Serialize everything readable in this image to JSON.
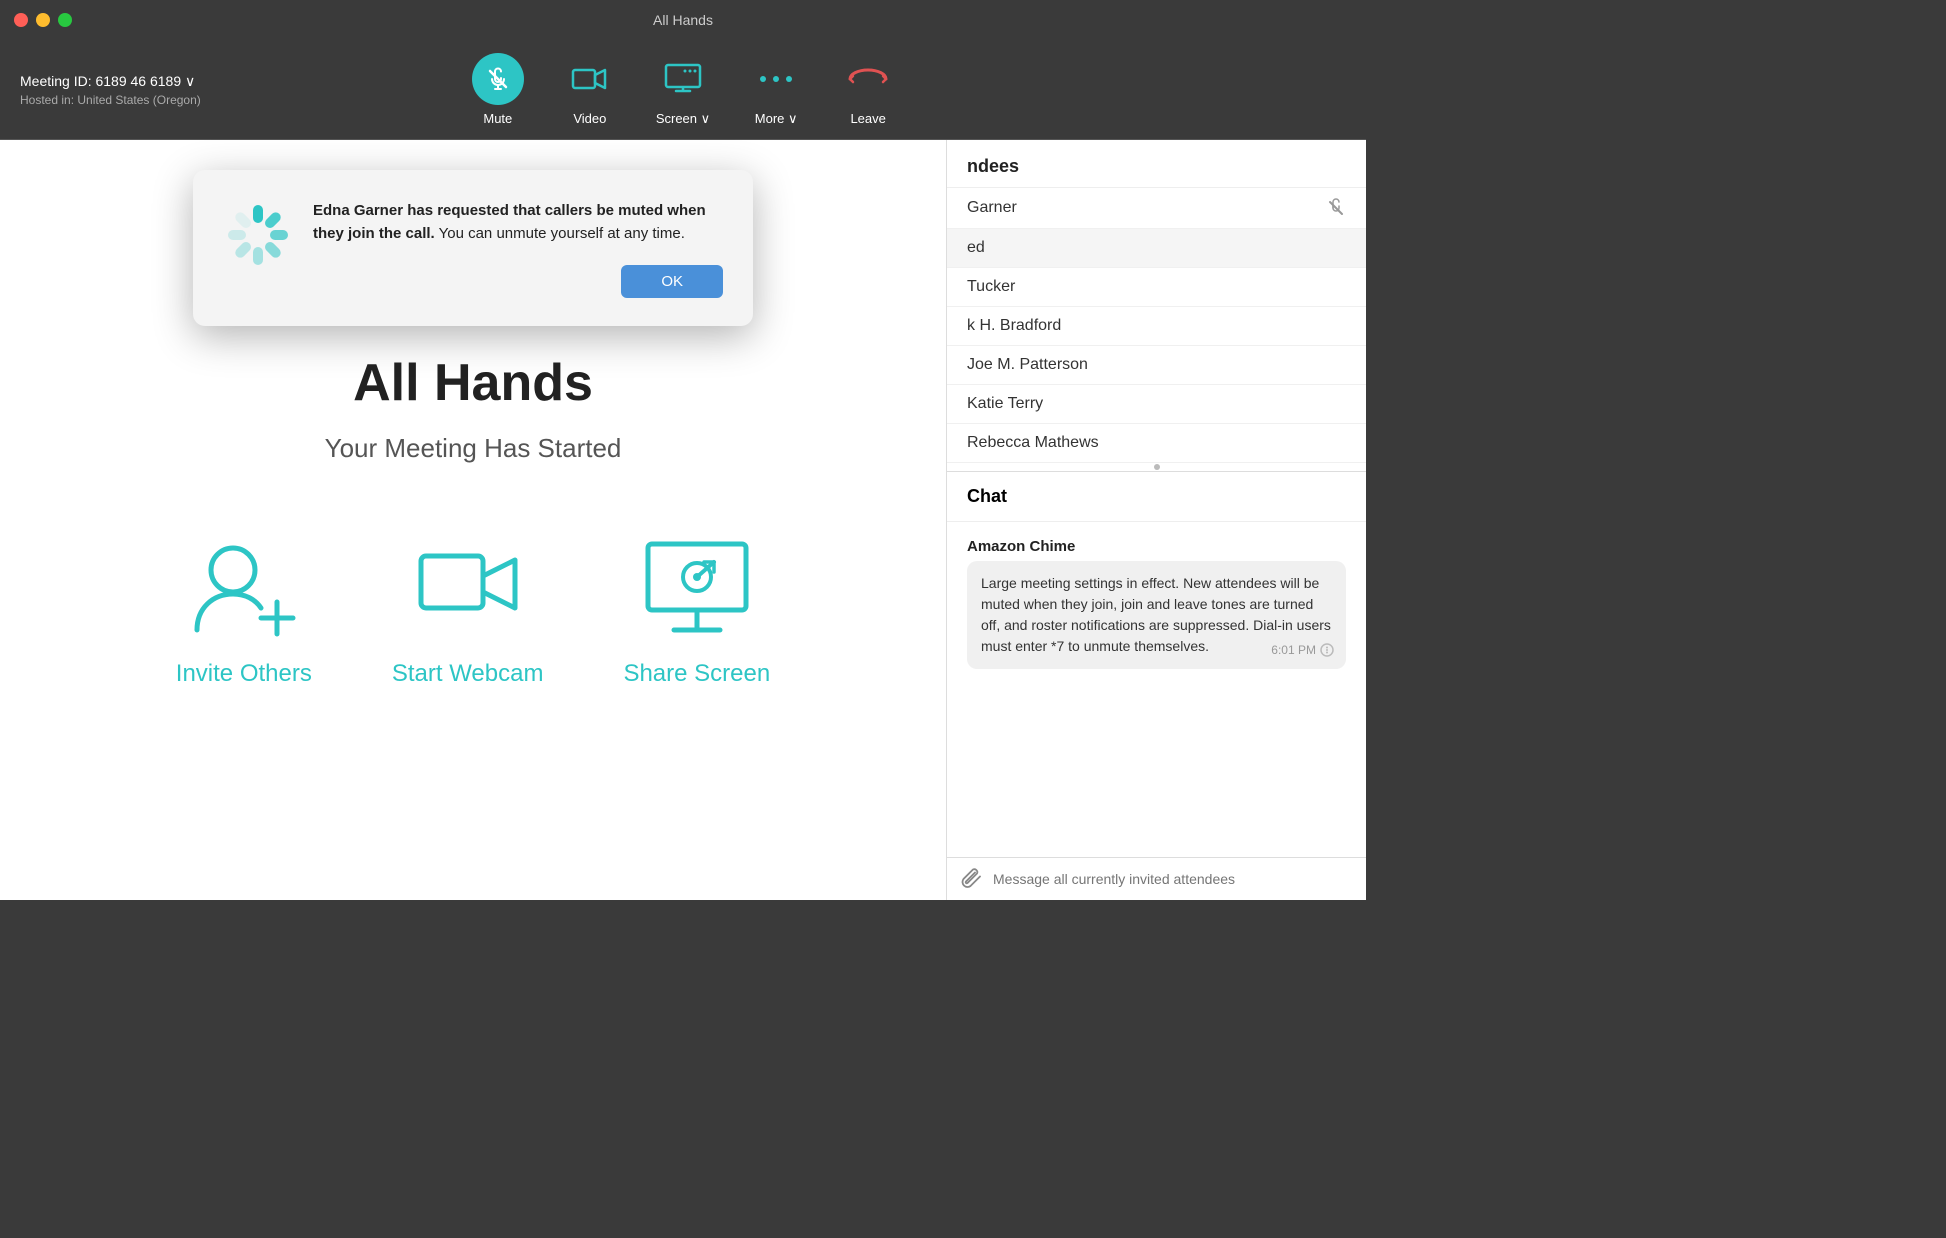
{
  "window": {
    "title": "All Hands"
  },
  "toolbar": {
    "mute_label": "Mute",
    "video_label": "Video",
    "screen_label": "Screen ∨",
    "more_label": "More ∨",
    "leave_label": "Leave"
  },
  "meeting": {
    "id_label": "Meeting ID: 6189 46 6189 ∨",
    "hosted_label": "Hosted in: United States (Oregon)",
    "title": "All Hands",
    "subtitle": "Your Meeting Has Started"
  },
  "actions": {
    "invite_label": "Invite Others",
    "webcam_label": "Start Webcam",
    "share_label": "Share Screen"
  },
  "sidebar": {
    "attendees_header": "ndees",
    "attendees": [
      {
        "name": "Garner",
        "highlighted": false,
        "muted": true
      },
      {
        "name": "ed",
        "highlighted": true,
        "muted": false
      },
      {
        "name": "Tucker",
        "highlighted": false,
        "muted": false
      },
      {
        "name": "k H. Bradford",
        "highlighted": false,
        "muted": false
      },
      {
        "name": "Joe M. Patterson",
        "highlighted": false,
        "muted": false
      },
      {
        "name": "Katie Terry",
        "highlighted": false,
        "muted": false
      },
      {
        "name": "Rebecca Mathews",
        "highlighted": false,
        "muted": false
      }
    ],
    "chat_header": "Chat",
    "chat_sender": "Amazon Chime",
    "chat_message": "Large meeting settings in effect. New attendees will be muted when they join, join and leave tones are turned off, and roster notifications are suppressed. Dial-in users must enter *7 to unmute themselves.",
    "chat_time": "6:01 PM",
    "chat_placeholder": "Message all currently invited attendees"
  },
  "dialog": {
    "message_bold": "Edna Garner has requested that callers be muted when they join the call.",
    "message_rest": " You can unmute yourself at any time.",
    "ok_label": "OK"
  }
}
